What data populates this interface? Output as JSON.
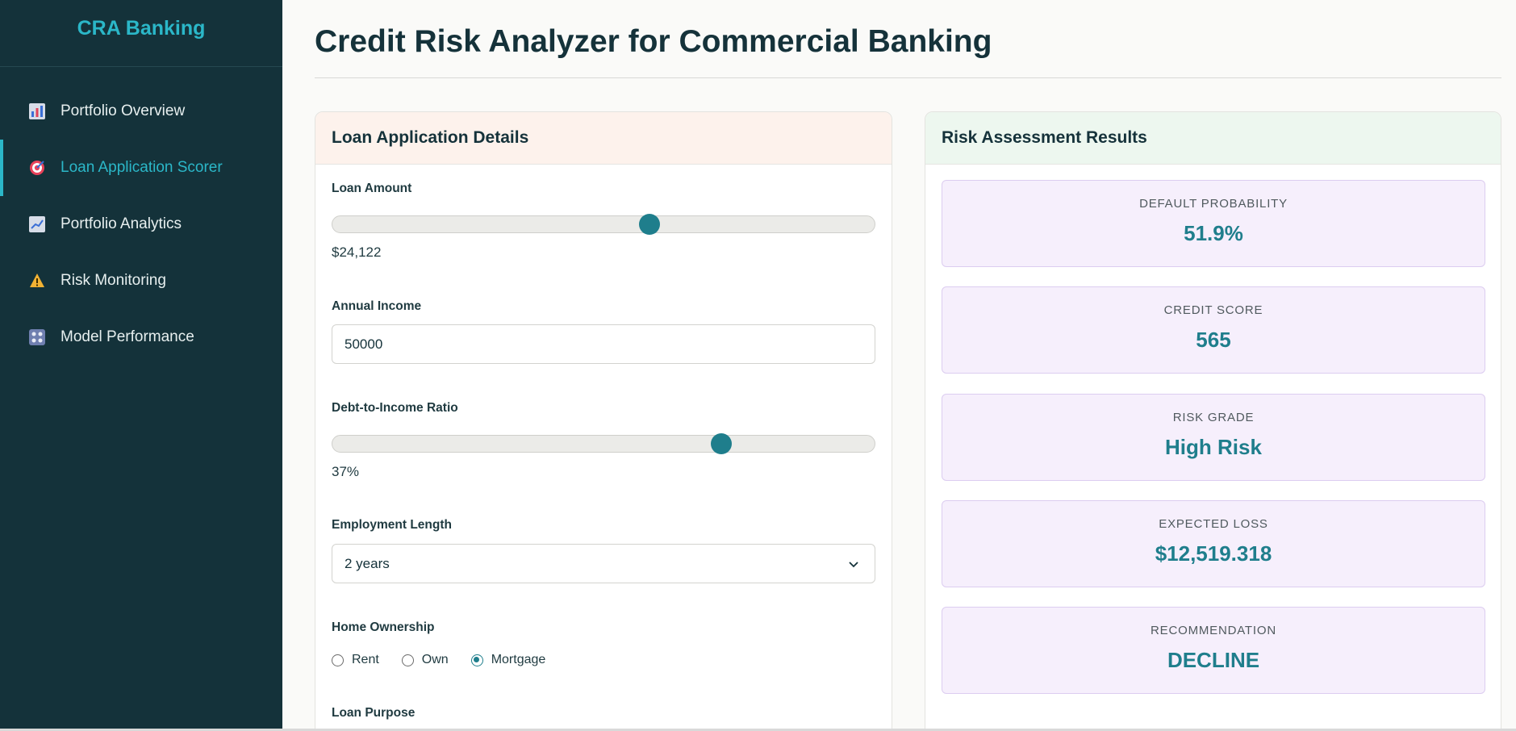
{
  "sidebar": {
    "brand": "CRA Banking",
    "items": [
      {
        "label": "Portfolio Overview",
        "icon": "bar-chart-icon",
        "active": false
      },
      {
        "label": "Loan Application Scorer",
        "icon": "target-icon",
        "active": true
      },
      {
        "label": "Portfolio Analytics",
        "icon": "line-chart-icon",
        "active": false
      },
      {
        "label": "Risk Monitoring",
        "icon": "warning-icon",
        "active": false
      },
      {
        "label": "Model Performance",
        "icon": "dashboard-icon",
        "active": false
      }
    ]
  },
  "page": {
    "title": "Credit Risk Analyzer for Commercial Banking"
  },
  "form": {
    "header": "Loan Application Details",
    "loan_amount": {
      "label": "Loan Amount",
      "value_text": "$24,122",
      "level_fraction": 0.585
    },
    "annual_income": {
      "label": "Annual Income",
      "value": "50000"
    },
    "dti": {
      "label": "Debt-to-Income Ratio",
      "value_text": "37%",
      "level_fraction": 0.718
    },
    "employment": {
      "label": "Employment Length",
      "selected": "2 years"
    },
    "home_ownership": {
      "label": "Home Ownership",
      "options": [
        "Rent",
        "Own",
        "Mortgage"
      ],
      "selected": "Mortgage"
    },
    "loan_purpose": {
      "label": "Loan Purpose"
    }
  },
  "results": {
    "header": "Risk Assessment Results",
    "metrics": [
      {
        "label": "DEFAULT PROBABILITY",
        "value": "51.9%"
      },
      {
        "label": "CREDIT SCORE",
        "value": "565"
      },
      {
        "label": "RISK GRADE",
        "value": "High Risk"
      },
      {
        "label": "EXPECTED LOSS",
        "value": "$12,519.318"
      },
      {
        "label": "RECOMMENDATION",
        "value": "DECLINE"
      }
    ]
  },
  "colors": {
    "sidebar_bg": "#14323a",
    "accent": "#2bb7c8",
    "primary": "#1f7e8c",
    "metric_bg": "#f6effc"
  }
}
